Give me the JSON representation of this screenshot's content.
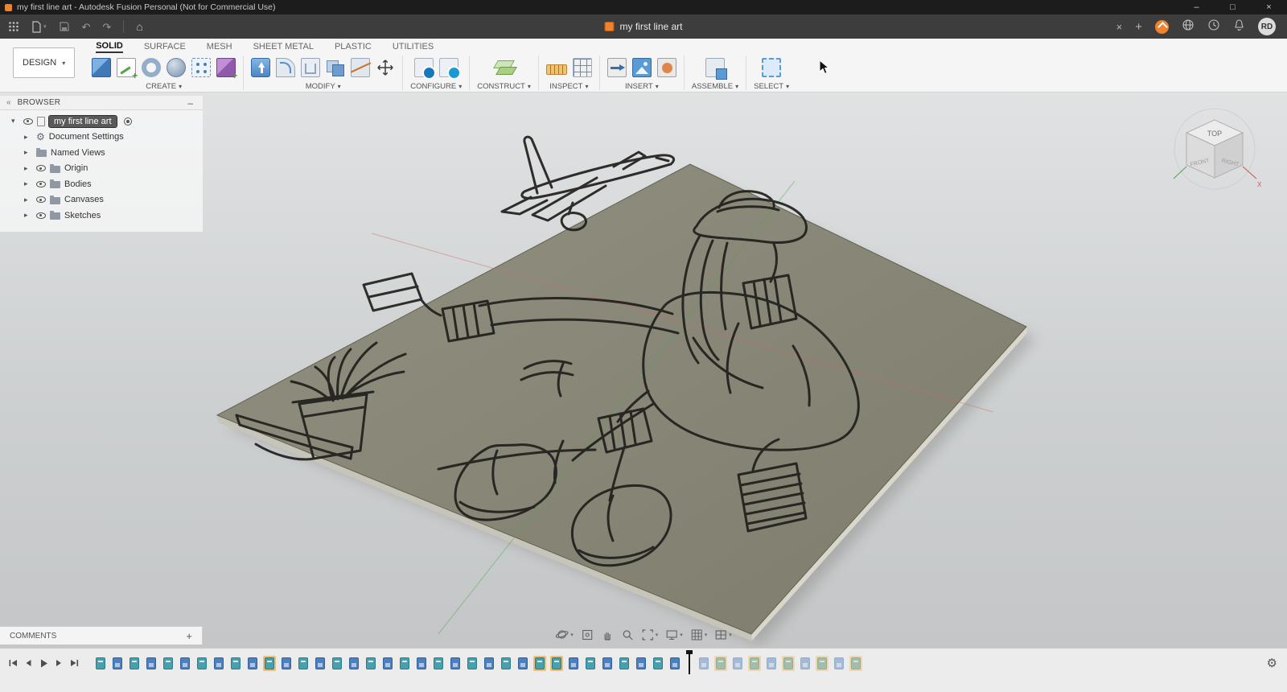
{
  "titlebar": {
    "title": "my first line art - Autodesk Fusion Personal (Not for Commercial Use)",
    "window_controls": {
      "minimize": "–",
      "maximize": "□",
      "close": "×"
    }
  },
  "appbar": {
    "left_icons": [
      "app-menu",
      "file-menu",
      "save",
      "undo",
      "redo",
      "home"
    ],
    "undo_glyph": "↶",
    "redo_glyph": "↷",
    "home_glyph": "⌂",
    "tab": {
      "label": "my first line art"
    },
    "right": {
      "close_tab": "×",
      "new_tab": "+",
      "avatar": "RD"
    }
  },
  "ribbon": {
    "design_button": {
      "label": "DESIGN"
    },
    "tabs": [
      {
        "label": "SOLID",
        "active": true
      },
      {
        "label": "SURFACE"
      },
      {
        "label": "MESH"
      },
      {
        "label": "SHEET METAL"
      },
      {
        "label": "PLASTIC"
      },
      {
        "label": "UTILITIES"
      }
    ],
    "groups": [
      {
        "label": "CREATE"
      },
      {
        "label": "MODIFY"
      },
      {
        "label": "CONFIGURE"
      },
      {
        "label": "CONSTRUCT"
      },
      {
        "label": "INSPECT"
      },
      {
        "label": "INSERT"
      },
      {
        "label": "ASSEMBLE"
      },
      {
        "label": "SELECT"
      }
    ]
  },
  "browser": {
    "collapse_icon": "«",
    "header": "BROWSER",
    "minimize_icon": "–",
    "items": [
      {
        "label": "my first line art",
        "icon": "document",
        "eye": true,
        "chevron": "down",
        "selected": true,
        "radio": true
      },
      {
        "label": "Document Settings",
        "icon": "gear",
        "chevron": "right",
        "child": true
      },
      {
        "label": "Named Views",
        "icon": "folder",
        "chevron": "right",
        "child": true
      },
      {
        "label": "Origin",
        "icon": "folder",
        "eye": true,
        "chevron": "right",
        "child": true
      },
      {
        "label": "Bodies",
        "icon": "folder",
        "eye": true,
        "chevron": "right",
        "child": true
      },
      {
        "label": "Canvases",
        "icon": "folder",
        "eye": true,
        "chevron": "right",
        "child": true
      },
      {
        "label": "Sketches",
        "icon": "folder",
        "eye": true,
        "chevron": "right",
        "child": true
      }
    ]
  },
  "viewport": {
    "viewcube": {
      "top": "TOP",
      "front": "FRONT",
      "right": "RIGHT",
      "axis_x": "X"
    },
    "description": "square plate body with extruded line art: seated figure in hat pouring toward a potted plant, airplane above"
  },
  "comments": {
    "label": "COMMENTS",
    "add_icon": "+"
  },
  "navbar": {
    "buttons": [
      "orbit",
      "look-at",
      "pan",
      "zoom",
      "fit",
      "display-settings",
      "grid-display",
      "viewports"
    ]
  },
  "timeline": {
    "playback": [
      "go-to-start",
      "step-back",
      "play",
      "step-forward",
      "go-to-end"
    ],
    "settings_icon": "⚙",
    "items": [
      {
        "type": "sketch"
      },
      {
        "type": "feature"
      },
      {
        "type": "sketch"
      },
      {
        "type": "feature"
      },
      {
        "type": "sketch"
      },
      {
        "type": "feature"
      },
      {
        "type": "sketch"
      },
      {
        "type": "feature"
      },
      {
        "type": "sketch"
      },
      {
        "type": "feature"
      },
      {
        "type": "sketch",
        "highlighted": true
      },
      {
        "type": "feature"
      },
      {
        "type": "sketch"
      },
      {
        "type": "feature"
      },
      {
        "type": "sketch"
      },
      {
        "type": "feature"
      },
      {
        "type": "sketch"
      },
      {
        "type": "feature"
      },
      {
        "type": "sketch"
      },
      {
        "type": "feature"
      },
      {
        "type": "sketch"
      },
      {
        "type": "feature"
      },
      {
        "type": "sketch"
      },
      {
        "type": "feature"
      },
      {
        "type": "sketch"
      },
      {
        "type": "feature"
      },
      {
        "type": "sketch",
        "highlighted": true
      },
      {
        "type": "sketch",
        "highlighted": true
      },
      {
        "type": "feature"
      },
      {
        "type": "sketch"
      },
      {
        "type": "feature"
      },
      {
        "type": "sketch"
      },
      {
        "type": "feature"
      },
      {
        "type": "sketch"
      },
      {
        "type": "feature"
      },
      {
        "type": "playhead"
      },
      {
        "type": "feature",
        "rolled": true
      },
      {
        "type": "sketch",
        "rolled": true,
        "highlighted": true
      },
      {
        "type": "feature",
        "rolled": true
      },
      {
        "type": "sketch",
        "rolled": true,
        "highlighted": true
      },
      {
        "type": "feature",
        "rolled": true
      },
      {
        "type": "sketch",
        "rolled": true,
        "highlighted": true
      },
      {
        "type": "feature",
        "rolled": true
      },
      {
        "type": "sketch",
        "rolled": true,
        "highlighted": true
      },
      {
        "type": "feature",
        "rolled": true
      },
      {
        "type": "sketch",
        "rolled": true,
        "highlighted": true
      }
    ]
  },
  "colors": {
    "plate": "#8a8779",
    "line_art": "#201f1c",
    "timeline_highlight": "#f2bf6f",
    "sketch_icon": "#47a0ad",
    "feature_icon": "#4b80c2",
    "brand_orange": "#f0822c"
  }
}
